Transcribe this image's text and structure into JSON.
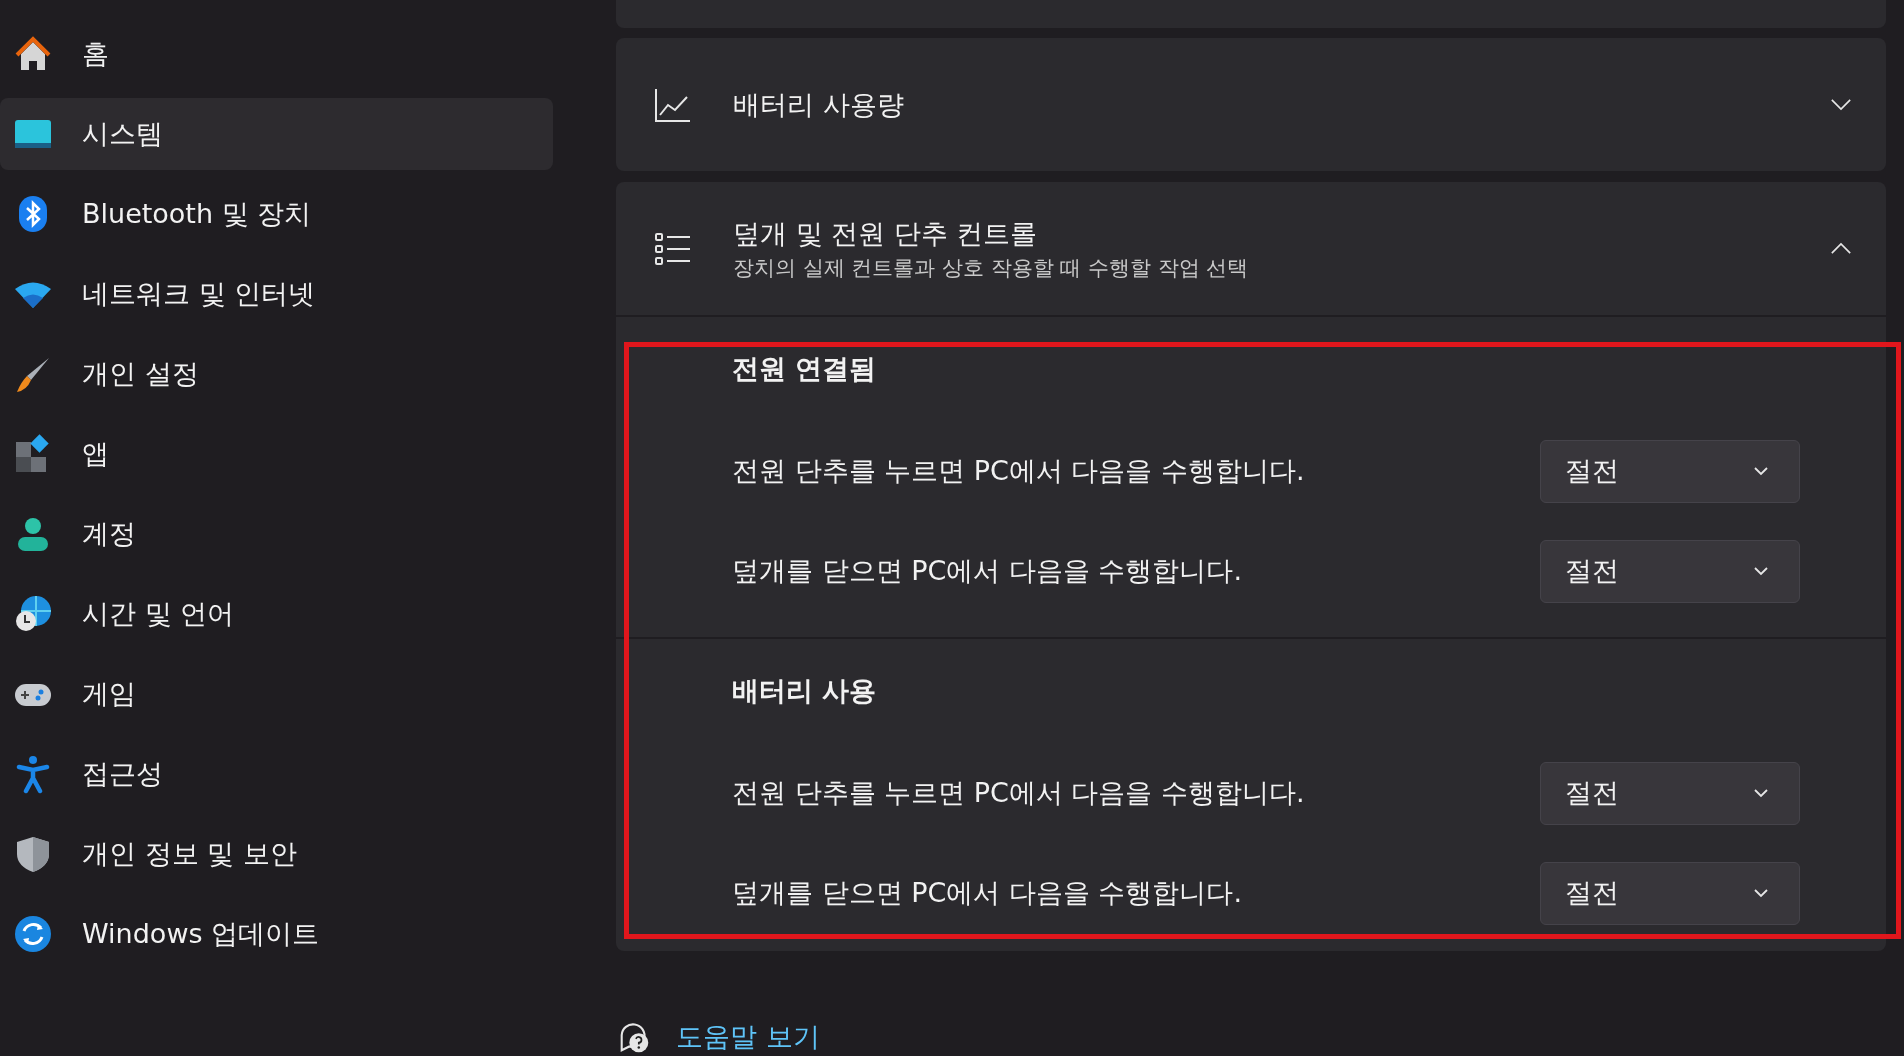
{
  "sidebar": {
    "items": [
      {
        "label": "홈",
        "selected": false
      },
      {
        "label": "시스템",
        "selected": true
      },
      {
        "label": "Bluetooth 및 장치",
        "selected": false
      },
      {
        "label": "네트워크 및 인터넷",
        "selected": false
      },
      {
        "label": "개인 설정",
        "selected": false
      },
      {
        "label": "앱",
        "selected": false
      },
      {
        "label": "계정",
        "selected": false
      },
      {
        "label": "시간 및 언어",
        "selected": false
      },
      {
        "label": "게임",
        "selected": false
      },
      {
        "label": "접근성",
        "selected": false
      },
      {
        "label": "개인 정보 및 보안",
        "selected": false
      },
      {
        "label": "Windows 업데이트",
        "selected": false
      }
    ]
  },
  "cards": [
    {
      "title": "배터리 사용량",
      "expanded": false
    },
    {
      "title": "덮개 및 전원 단추 컨트롤",
      "subtitle": "장치의 실제 컨트롤과 상호 작용할 때 수행할 작업 선택",
      "expanded": true,
      "sections": [
        {
          "heading": "전원 연결됨",
          "rows": [
            {
              "label": "전원 단추를 누르면 PC에서 다음을 수행합니다.",
              "value": "절전"
            },
            {
              "label": "덮개를 닫으면 PC에서 다음을 수행합니다.",
              "value": "절전"
            }
          ]
        },
        {
          "heading": "배터리 사용",
          "rows": [
            {
              "label": "전원 단추를 누르면 PC에서 다음을 수행합니다.",
              "value": "절전"
            },
            {
              "label": "덮개를 닫으면 PC에서 다음을 수행합니다.",
              "value": "절전"
            }
          ]
        }
      ]
    }
  ],
  "help_link": "도움말 보기",
  "annotation": {
    "kind": "frame",
    "color": "#e0161c"
  }
}
